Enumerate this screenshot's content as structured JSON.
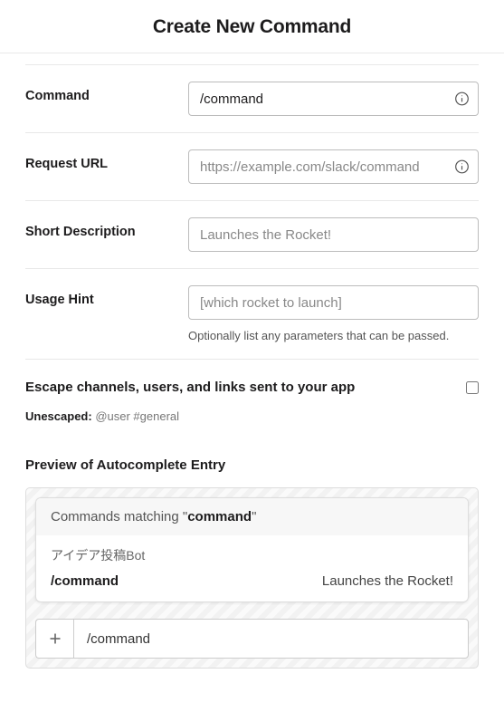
{
  "header": {
    "title": "Create New Command"
  },
  "fields": {
    "command": {
      "label": "Command",
      "value": "/command"
    },
    "request_url": {
      "label": "Request URL",
      "placeholder": "https://example.com/slack/command"
    },
    "short_desc": {
      "label": "Short Description",
      "placeholder": "Launches the Rocket!"
    },
    "usage_hint": {
      "label": "Usage Hint",
      "placeholder": "[which rocket to launch]",
      "help": "Optionally list any parameters that can be passed."
    }
  },
  "escape": {
    "title": "Escape channels, users, and links sent to your app",
    "sub_label": "Unescaped:",
    "sub_value": "@user #general"
  },
  "preview": {
    "title": "Preview of Autocomplete Entry",
    "matching_prefix": "Commands matching \"",
    "matching_term": "command",
    "matching_suffix": "\"",
    "bot_name": "アイデア投稿Bot",
    "command": "/command",
    "description": "Launches the Rocket!",
    "input_value": "/command"
  }
}
